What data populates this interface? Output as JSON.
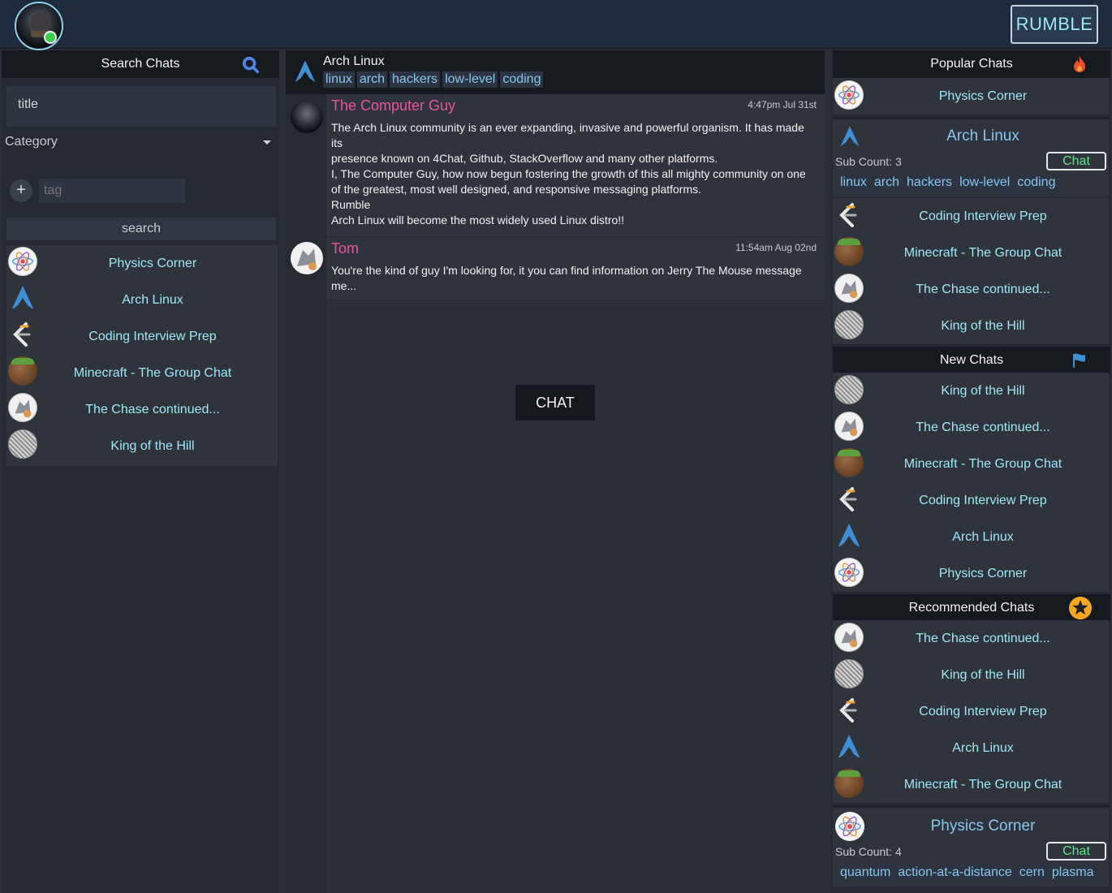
{
  "app": {
    "brand": "RUMBLE"
  },
  "left": {
    "header": "Search Chats",
    "title_placeholder": "title",
    "category_label": "Category",
    "tag_placeholder": "tag",
    "search_label": "search",
    "results": [
      {
        "label": "Physics Corner",
        "icon": "physics-icon"
      },
      {
        "label": "Arch Linux",
        "icon": "arch-icon"
      },
      {
        "label": "Coding Interview Prep",
        "icon": "code-icon"
      },
      {
        "label": "Minecraft - The Group Chat",
        "icon": "minecraft-icon"
      },
      {
        "label": "The Chase continued...",
        "icon": "tom-icon"
      },
      {
        "label": "King of the Hill",
        "icon": "maze-icon"
      }
    ]
  },
  "center": {
    "title": "Arch Linux",
    "tags": [
      "linux",
      "arch",
      "hackers",
      "low-level",
      "coding"
    ],
    "messages": [
      {
        "author": "The Computer Guy",
        "time": "4:47pm Jul 31st",
        "body": "The Arch Linux community is an ever expanding, invasive and powerful organism. It has made its\npresence known on 4Chat, Github, StackOverflow and many other platforms.\nI, The Computer Guy, how now begun fostering the growth of this all mighty community on one of the greatest, most well designed, and responsive messaging platforms.\nRumble\nArch Linux will become the most widely used Linux distro!!"
      },
      {
        "author": "Tom",
        "time": "11:54am Aug 02nd",
        "body": "You're the kind of guy I'm looking for, it you can find information on Jerry The Mouse message me..."
      }
    ],
    "chat_button": "CHAT"
  },
  "right": {
    "popular_header": "Popular Chats",
    "popular": [
      {
        "label": "Physics Corner"
      }
    ],
    "arch_card": {
      "title": "Arch Linux",
      "sub_count": "Sub Count: 3",
      "chat_label": "Chat",
      "tags": [
        "linux",
        "arch",
        "hackers",
        "low-level",
        "coding"
      ]
    },
    "popular_rest": [
      {
        "label": "Coding Interview Prep"
      },
      {
        "label": "Minecraft - The Group Chat"
      },
      {
        "label": "The Chase continued..."
      },
      {
        "label": "King of the Hill"
      }
    ],
    "new_header": "New Chats",
    "new": [
      {
        "label": "King of the Hill"
      },
      {
        "label": "The Chase continued..."
      },
      {
        "label": "Minecraft - The Group Chat"
      },
      {
        "label": "Coding Interview Prep"
      },
      {
        "label": "Arch Linux"
      },
      {
        "label": "Physics Corner"
      }
    ],
    "recommended_header": "Recommended Chats",
    "recommended": [
      {
        "label": "The Chase continued..."
      },
      {
        "label": "King of the Hill"
      },
      {
        "label": "Coding Interview Prep"
      },
      {
        "label": "Arch Linux"
      },
      {
        "label": "Minecraft - The Group Chat"
      }
    ],
    "physics_card": {
      "title": "Physics Corner",
      "sub_count": "Sub Count: 4",
      "chat_label": "Chat",
      "tags": [
        "quantum",
        "action-at-a-distance",
        "cern",
        "plasma"
      ]
    }
  },
  "colors": {
    "accent": "#9ee7f5",
    "author": "#e8559a",
    "chat_green": "#63e08c",
    "online": "#3ecf4a"
  }
}
